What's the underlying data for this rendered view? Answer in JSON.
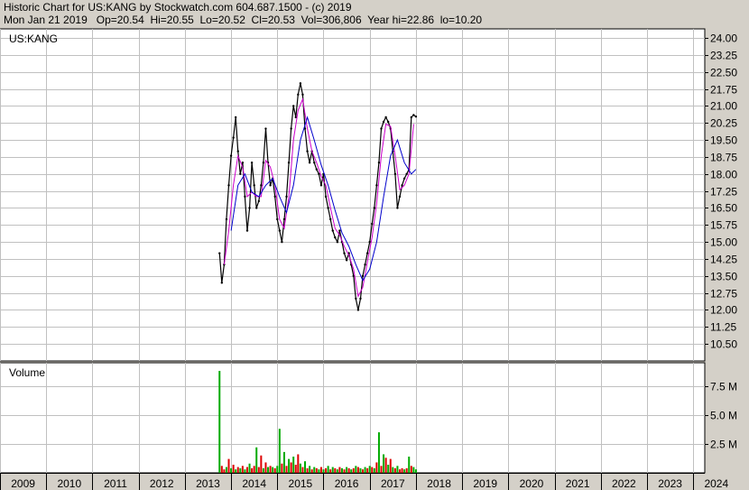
{
  "header": {
    "line1": "Historic Chart for US:KANG by Stockwatch.com 604.687.1500 - (c) 2019",
    "line2": "Mon Jan 21 2019   Op=20.54  Hi=20.55  Lo=20.52  Cl=20.53  Vol=306,806  Year hi=22.86  lo=10.20"
  },
  "chart_data": {
    "type": "line",
    "title": "US:KANG",
    "price_axis": {
      "ticks": [
        "24.00",
        "23.25",
        "22.50",
        "21.75",
        "21.00",
        "20.25",
        "19.50",
        "18.75",
        "18.00",
        "17.25",
        "16.50",
        "15.75",
        "15.00",
        "14.25",
        "13.50",
        "12.75",
        "12.00",
        "11.25",
        "10.50"
      ],
      "ylim": [
        9.75,
        24.4
      ]
    },
    "volume_axis": {
      "label": "Volume",
      "ticks": [
        "7.5 M",
        "5.0 M",
        "2.5 M"
      ],
      "ylim": [
        0,
        9.5
      ]
    },
    "x_axis": {
      "years": [
        "2009",
        "2010",
        "2011",
        "2012",
        "2013",
        "2014",
        "2015",
        "2016",
        "2017",
        "2018",
        "2019",
        "2020",
        "2021",
        "2022",
        "2023",
        "2024"
      ],
      "xlim": [
        2009.0,
        2024.25
      ]
    },
    "grid": true,
    "colors": {
      "price": "#000000",
      "ma_short": "#cc00cc",
      "ma_long": "#0000cc",
      "vol_up": "#00aa00",
      "vol_down": "#dd0000"
    },
    "series": [
      {
        "role": "price",
        "points": [
          [
            2013.75,
            14.5
          ],
          [
            2013.8,
            13.2
          ],
          [
            2013.85,
            14.0
          ],
          [
            2013.9,
            16.0
          ],
          [
            2013.95,
            17.5
          ],
          [
            2014.0,
            18.8
          ],
          [
            2014.05,
            19.6
          ],
          [
            2014.1,
            20.5
          ],
          [
            2014.15,
            19.0
          ],
          [
            2014.2,
            18.0
          ],
          [
            2014.25,
            18.5
          ],
          [
            2014.3,
            17.0
          ],
          [
            2014.35,
            15.5
          ],
          [
            2014.4,
            16.5
          ],
          [
            2014.45,
            18.5
          ],
          [
            2014.5,
            17.5
          ],
          [
            2014.55,
            16.5
          ],
          [
            2014.6,
            16.8
          ],
          [
            2014.65,
            17.5
          ],
          [
            2014.7,
            18.5
          ],
          [
            2014.75,
            20.0
          ],
          [
            2014.8,
            18.5
          ],
          [
            2014.85,
            17.5
          ],
          [
            2014.9,
            17.8
          ],
          [
            2014.95,
            17.0
          ],
          [
            2015.0,
            16.0
          ],
          [
            2015.05,
            15.5
          ],
          [
            2015.1,
            15.0
          ],
          [
            2015.15,
            16.0
          ],
          [
            2015.2,
            17.0
          ],
          [
            2015.25,
            18.5
          ],
          [
            2015.3,
            20.0
          ],
          [
            2015.35,
            21.0
          ],
          [
            2015.4,
            20.5
          ],
          [
            2015.45,
            21.5
          ],
          [
            2015.5,
            22.0
          ],
          [
            2015.55,
            21.5
          ],
          [
            2015.6,
            20.0
          ],
          [
            2015.65,
            19.0
          ],
          [
            2015.7,
            18.5
          ],
          [
            2015.75,
            19.0
          ],
          [
            2015.8,
            18.5
          ],
          [
            2015.85,
            18.2
          ],
          [
            2015.9,
            18.0
          ],
          [
            2015.95,
            17.5
          ],
          [
            2016.0,
            18.0
          ],
          [
            2016.05,
            17.0
          ],
          [
            2016.1,
            16.5
          ],
          [
            2016.15,
            16.0
          ],
          [
            2016.2,
            15.5
          ],
          [
            2016.25,
            15.2
          ],
          [
            2016.3,
            15.0
          ],
          [
            2016.35,
            15.5
          ],
          [
            2016.4,
            15.0
          ],
          [
            2016.45,
            14.5
          ],
          [
            2016.5,
            14.2
          ],
          [
            2016.55,
            14.5
          ],
          [
            2016.6,
            14.0
          ],
          [
            2016.65,
            13.5
          ],
          [
            2016.7,
            12.5
          ],
          [
            2016.75,
            12.0
          ],
          [
            2016.8,
            12.5
          ],
          [
            2016.85,
            13.5
          ],
          [
            2016.9,
            14.0
          ],
          [
            2016.95,
            14.5
          ],
          [
            2017.0,
            15.0
          ],
          [
            2017.05,
            15.8
          ],
          [
            2017.1,
            16.5
          ],
          [
            2017.15,
            17.5
          ],
          [
            2017.2,
            18.5
          ],
          [
            2017.25,
            20.0
          ],
          [
            2017.3,
            20.3
          ],
          [
            2017.35,
            20.5
          ],
          [
            2017.4,
            20.3
          ],
          [
            2017.45,
            20.0
          ],
          [
            2017.5,
            19.0
          ],
          [
            2017.55,
            18.0
          ],
          [
            2017.6,
            16.5
          ],
          [
            2017.65,
            17.0
          ],
          [
            2017.7,
            17.5
          ],
          [
            2017.75,
            17.8
          ],
          [
            2017.8,
            18.0
          ],
          [
            2017.85,
            18.2
          ],
          [
            2017.9,
            20.5
          ],
          [
            2017.95,
            20.6
          ],
          [
            2018.0,
            20.53
          ]
        ]
      },
      {
        "role": "ma_short",
        "points": [
          [
            2013.85,
            14.0
          ],
          [
            2013.95,
            15.5
          ],
          [
            2014.05,
            17.5
          ],
          [
            2014.15,
            18.8
          ],
          [
            2014.25,
            18.3
          ],
          [
            2014.35,
            17.0
          ],
          [
            2014.45,
            17.2
          ],
          [
            2014.55,
            17.0
          ],
          [
            2014.65,
            17.0
          ],
          [
            2014.75,
            18.6
          ],
          [
            2014.85,
            18.3
          ],
          [
            2014.95,
            17.5
          ],
          [
            2015.05,
            16.0
          ],
          [
            2015.15,
            15.6
          ],
          [
            2015.25,
            17.0
          ],
          [
            2015.35,
            19.5
          ],
          [
            2015.45,
            20.8
          ],
          [
            2015.55,
            21.3
          ],
          [
            2015.65,
            20.0
          ],
          [
            2015.75,
            19.0
          ],
          [
            2015.85,
            18.5
          ],
          [
            2015.95,
            17.9
          ],
          [
            2016.05,
            17.5
          ],
          [
            2016.15,
            16.5
          ],
          [
            2016.25,
            15.6
          ],
          [
            2016.35,
            15.3
          ],
          [
            2016.45,
            14.8
          ],
          [
            2016.55,
            14.4
          ],
          [
            2016.65,
            13.8
          ],
          [
            2016.75,
            12.6
          ],
          [
            2016.85,
            13.0
          ],
          [
            2016.95,
            14.1
          ],
          [
            2017.05,
            15.2
          ],
          [
            2017.15,
            16.7
          ],
          [
            2017.25,
            18.8
          ],
          [
            2017.35,
            20.2
          ],
          [
            2017.45,
            20.1
          ],
          [
            2017.55,
            18.8
          ],
          [
            2017.65,
            17.3
          ],
          [
            2017.75,
            17.5
          ],
          [
            2017.85,
            18.0
          ],
          [
            2017.95,
            20.2
          ]
        ]
      },
      {
        "role": "ma_long",
        "points": [
          [
            2014.0,
            15.5
          ],
          [
            2014.15,
            17.5
          ],
          [
            2014.3,
            18.0
          ],
          [
            2014.45,
            17.2
          ],
          [
            2014.6,
            17.0
          ],
          [
            2014.75,
            17.5
          ],
          [
            2014.9,
            17.8
          ],
          [
            2015.05,
            17.0
          ],
          [
            2015.2,
            16.3
          ],
          [
            2015.35,
            17.5
          ],
          [
            2015.5,
            19.5
          ],
          [
            2015.65,
            20.5
          ],
          [
            2015.8,
            19.5
          ],
          [
            2015.95,
            18.4
          ],
          [
            2016.1,
            17.5
          ],
          [
            2016.25,
            16.4
          ],
          [
            2016.4,
            15.4
          ],
          [
            2016.55,
            14.8
          ],
          [
            2016.7,
            14.0
          ],
          [
            2016.85,
            13.3
          ],
          [
            2017.0,
            13.8
          ],
          [
            2017.15,
            15.0
          ],
          [
            2017.3,
            17.0
          ],
          [
            2017.45,
            18.8
          ],
          [
            2017.6,
            19.5
          ],
          [
            2017.75,
            18.5
          ],
          [
            2017.9,
            18.0
          ],
          [
            2018.0,
            18.2
          ]
        ]
      }
    ],
    "volume": [
      [
        2013.75,
        8.8,
        "up"
      ],
      [
        2013.8,
        0.6,
        "down"
      ],
      [
        2013.85,
        0.3,
        "down"
      ],
      [
        2013.9,
        0.5,
        "up"
      ],
      [
        2013.95,
        1.2,
        "down"
      ],
      [
        2014.0,
        0.4,
        "up"
      ],
      [
        2014.05,
        0.7,
        "down"
      ],
      [
        2014.1,
        0.3,
        "up"
      ],
      [
        2014.15,
        0.5,
        "down"
      ],
      [
        2014.2,
        0.4,
        "up"
      ],
      [
        2014.25,
        0.6,
        "down"
      ],
      [
        2014.3,
        0.3,
        "up"
      ],
      [
        2014.35,
        0.5,
        "down"
      ],
      [
        2014.4,
        0.8,
        "up"
      ],
      [
        2014.45,
        0.4,
        "down"
      ],
      [
        2014.5,
        0.6,
        "down"
      ],
      [
        2014.55,
        2.2,
        "up"
      ],
      [
        2014.6,
        0.5,
        "down"
      ],
      [
        2014.65,
        1.5,
        "down"
      ],
      [
        2014.7,
        0.4,
        "up"
      ],
      [
        2014.75,
        0.9,
        "down"
      ],
      [
        2014.8,
        0.5,
        "up"
      ],
      [
        2014.85,
        0.6,
        "down"
      ],
      [
        2014.9,
        0.5,
        "up"
      ],
      [
        2014.95,
        0.4,
        "down"
      ],
      [
        2015.0,
        0.6,
        "up"
      ],
      [
        2015.05,
        3.8,
        "up"
      ],
      [
        2015.1,
        0.8,
        "down"
      ],
      [
        2015.15,
        1.8,
        "up"
      ],
      [
        2015.2,
        0.6,
        "down"
      ],
      [
        2015.25,
        1.2,
        "up"
      ],
      [
        2015.3,
        0.9,
        "down"
      ],
      [
        2015.35,
        1.4,
        "up"
      ],
      [
        2015.4,
        0.7,
        "down"
      ],
      [
        2015.45,
        1.6,
        "down"
      ],
      [
        2015.5,
        0.8,
        "up"
      ],
      [
        2015.55,
        0.5,
        "down"
      ],
      [
        2015.6,
        1.0,
        "up"
      ],
      [
        2015.65,
        0.4,
        "down"
      ],
      [
        2015.7,
        0.6,
        "up"
      ],
      [
        2015.75,
        0.3,
        "down"
      ],
      [
        2015.8,
        0.5,
        "up"
      ],
      [
        2015.85,
        0.4,
        "down"
      ],
      [
        2015.9,
        0.3,
        "up"
      ],
      [
        2015.95,
        0.5,
        "down"
      ],
      [
        2016.0,
        0.3,
        "up"
      ],
      [
        2016.05,
        0.4,
        "down"
      ],
      [
        2016.1,
        0.6,
        "up"
      ],
      [
        2016.15,
        0.3,
        "down"
      ],
      [
        2016.2,
        0.5,
        "up"
      ],
      [
        2016.25,
        0.4,
        "down"
      ],
      [
        2016.3,
        0.3,
        "up"
      ],
      [
        2016.35,
        0.5,
        "down"
      ],
      [
        2016.4,
        0.4,
        "up"
      ],
      [
        2016.45,
        0.3,
        "down"
      ],
      [
        2016.5,
        0.5,
        "up"
      ],
      [
        2016.55,
        0.4,
        "down"
      ],
      [
        2016.6,
        0.3,
        "up"
      ],
      [
        2016.65,
        0.4,
        "down"
      ],
      [
        2016.7,
        0.6,
        "up"
      ],
      [
        2016.75,
        0.5,
        "down"
      ],
      [
        2016.8,
        0.4,
        "up"
      ],
      [
        2016.85,
        0.3,
        "down"
      ],
      [
        2016.9,
        0.5,
        "up"
      ],
      [
        2016.95,
        0.4,
        "down"
      ],
      [
        2017.0,
        0.6,
        "up"
      ],
      [
        2017.05,
        0.5,
        "down"
      ],
      [
        2017.1,
        0.4,
        "up"
      ],
      [
        2017.15,
        0.9,
        "down"
      ],
      [
        2017.2,
        3.5,
        "up"
      ],
      [
        2017.25,
        0.6,
        "down"
      ],
      [
        2017.3,
        1.6,
        "up"
      ],
      [
        2017.35,
        1.3,
        "down"
      ],
      [
        2017.4,
        0.7,
        "up"
      ],
      [
        2017.45,
        1.2,
        "down"
      ],
      [
        2017.5,
        0.5,
        "up"
      ],
      [
        2017.55,
        0.4,
        "down"
      ],
      [
        2017.6,
        0.6,
        "up"
      ],
      [
        2017.65,
        0.3,
        "down"
      ],
      [
        2017.7,
        0.4,
        "down"
      ],
      [
        2017.75,
        0.3,
        "up"
      ],
      [
        2017.8,
        0.4,
        "down"
      ],
      [
        2017.85,
        1.4,
        "up"
      ],
      [
        2017.9,
        0.6,
        "down"
      ],
      [
        2017.95,
        0.5,
        "up"
      ],
      [
        2018.0,
        0.3,
        "up"
      ]
    ]
  }
}
